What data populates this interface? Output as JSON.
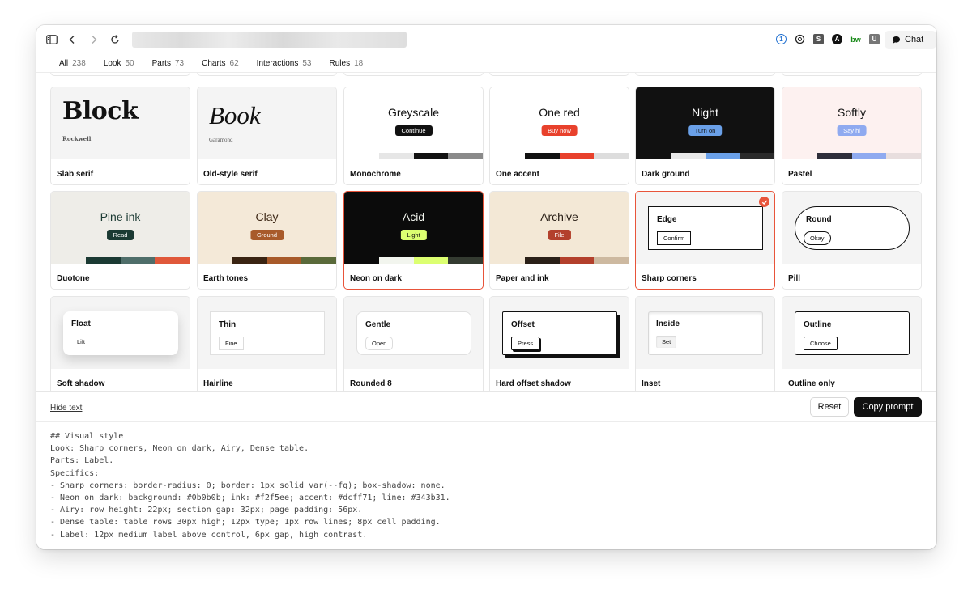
{
  "toolbar": {
    "extensions": [
      "1",
      "",
      "S",
      "A",
      "bw",
      "U"
    ],
    "chat_label": "Chat"
  },
  "tabs": [
    {
      "label": "All",
      "count": "238",
      "active": true
    },
    {
      "label": "Look",
      "count": "50"
    },
    {
      "label": "Parts",
      "count": "73"
    },
    {
      "label": "Charts",
      "count": "62"
    },
    {
      "label": "Interactions",
      "count": "53"
    },
    {
      "label": "Rules",
      "count": "18"
    }
  ],
  "row1": [
    {
      "label": "Slab serif",
      "hero": "Block",
      "sub": "Rockwell"
    },
    {
      "label": "Old-style serif",
      "hero": "Book",
      "sub": "Garamond"
    },
    {
      "label": "Monochrome",
      "hero": "Greyscale",
      "button": "Continue",
      "bg": "#ffffff",
      "ink": "#111111",
      "btn_bg": "#111111",
      "btn_ink": "#ffffff",
      "strip": [
        "#ffffff",
        "#e6e6e6",
        "#111111",
        "#8a8a8a"
      ]
    },
    {
      "label": "One accent",
      "hero": "One red",
      "button": "Buy now",
      "bg": "#ffffff",
      "ink": "#111111",
      "btn_bg": "#e8412c",
      "btn_ink": "#ffffff",
      "strip": [
        "#ffffff",
        "#111111",
        "#e8412c",
        "#dddddd"
      ]
    },
    {
      "label": "Dark ground",
      "hero": "Night",
      "button": "Turn on",
      "bg": "#111111",
      "ink": "#ffffff",
      "btn_bg": "#6aa0e8",
      "btn_ink": "#111111",
      "strip": [
        "#111111",
        "#e8e8e8",
        "#6aa0e8",
        "#2a2a2a"
      ]
    },
    {
      "label": "Pastel",
      "hero": "Softly",
      "button": "Say hi",
      "bg": "#fdf1f0",
      "ink": "#111111",
      "btn_bg": "#8faaf0",
      "btn_ink": "#ffffff",
      "strip": [
        "#fdf1f0",
        "#2e2e3a",
        "#8faaf0",
        "#e8dede"
      ]
    }
  ],
  "row2": [
    {
      "label": "Duotone",
      "hero": "Pine ink",
      "button": "Read",
      "bg": "#eeede8",
      "ink": "#1b3a33",
      "btn_bg": "#1b3a33",
      "btn_ink": "#ffffff",
      "strip": [
        "#eeede8",
        "#1b3a33",
        "#4f6e6a",
        "#e0583a"
      ]
    },
    {
      "label": "Earth tones",
      "hero": "Clay",
      "button": "Ground",
      "bg": "#f4e9d8",
      "ink": "#3a2412",
      "btn_bg": "#a85a2a",
      "btn_ink": "#ffffff",
      "strip": [
        "#f4e9d8",
        "#3a2412",
        "#a85a2a",
        "#5a6a3a"
      ]
    },
    {
      "label": "Neon on dark",
      "hero": "Acid",
      "button": "Light",
      "bg": "#0b0b0b",
      "ink": "#f2f5ee",
      "btn_bg": "#dcff71",
      "btn_ink": "#111111",
      "strip": [
        "#0b0b0b",
        "#f2f5ee",
        "#dcff71",
        "#343b31"
      ],
      "selected": true
    },
    {
      "label": "Paper and ink",
      "hero": "Archive",
      "button": "File",
      "bg": "#f3e8d6",
      "ink": "#2a2018",
      "btn_bg": "#b3402c",
      "btn_ink": "#ffffff",
      "strip": [
        "#f3e8d6",
        "#2a2018",
        "#b3402c",
        "#cdb9a0"
      ]
    },
    {
      "label": "Sharp corners",
      "hero": "Edge",
      "button": "Confirm",
      "selected": true
    },
    {
      "label": "Pill",
      "hero": "Round",
      "button": "Okay"
    }
  ],
  "row3": [
    {
      "label": "Soft shadow",
      "hero": "Float",
      "button": "Lift"
    },
    {
      "label": "Hairline",
      "hero": "Thin",
      "button": "Fine"
    },
    {
      "label": "Rounded 8",
      "hero": "Gentle",
      "button": "Open"
    },
    {
      "label": "Hard offset shadow",
      "hero": "Offset",
      "button": "Press"
    },
    {
      "label": "Inset",
      "hero": "Inside",
      "button": "Set"
    },
    {
      "label": "Outline only",
      "hero": "Outline",
      "button": "Choose"
    }
  ],
  "footer": {
    "hide_text": "Hide text",
    "reset": "Reset",
    "copy": "Copy prompt"
  },
  "prompt": "## Visual style\nLook: Sharp corners, Neon on dark, Airy, Dense table.\nParts: Label.\nSpecifics:\n- Sharp corners: border-radius: 0; border: 1px solid var(--fg); box-shadow: none.\n- Neon on dark: background: #0b0b0b; ink: #f2f5ee; accent: #dcff71; line: #343b31.\n- Airy: row height: 22px; section gap: 32px; page padding: 56px.\n- Dense table: table rows 30px high; 12px type; 1px row lines; 8px cell padding.\n- Label: 12px medium label above control, 6px gap, high contrast."
}
